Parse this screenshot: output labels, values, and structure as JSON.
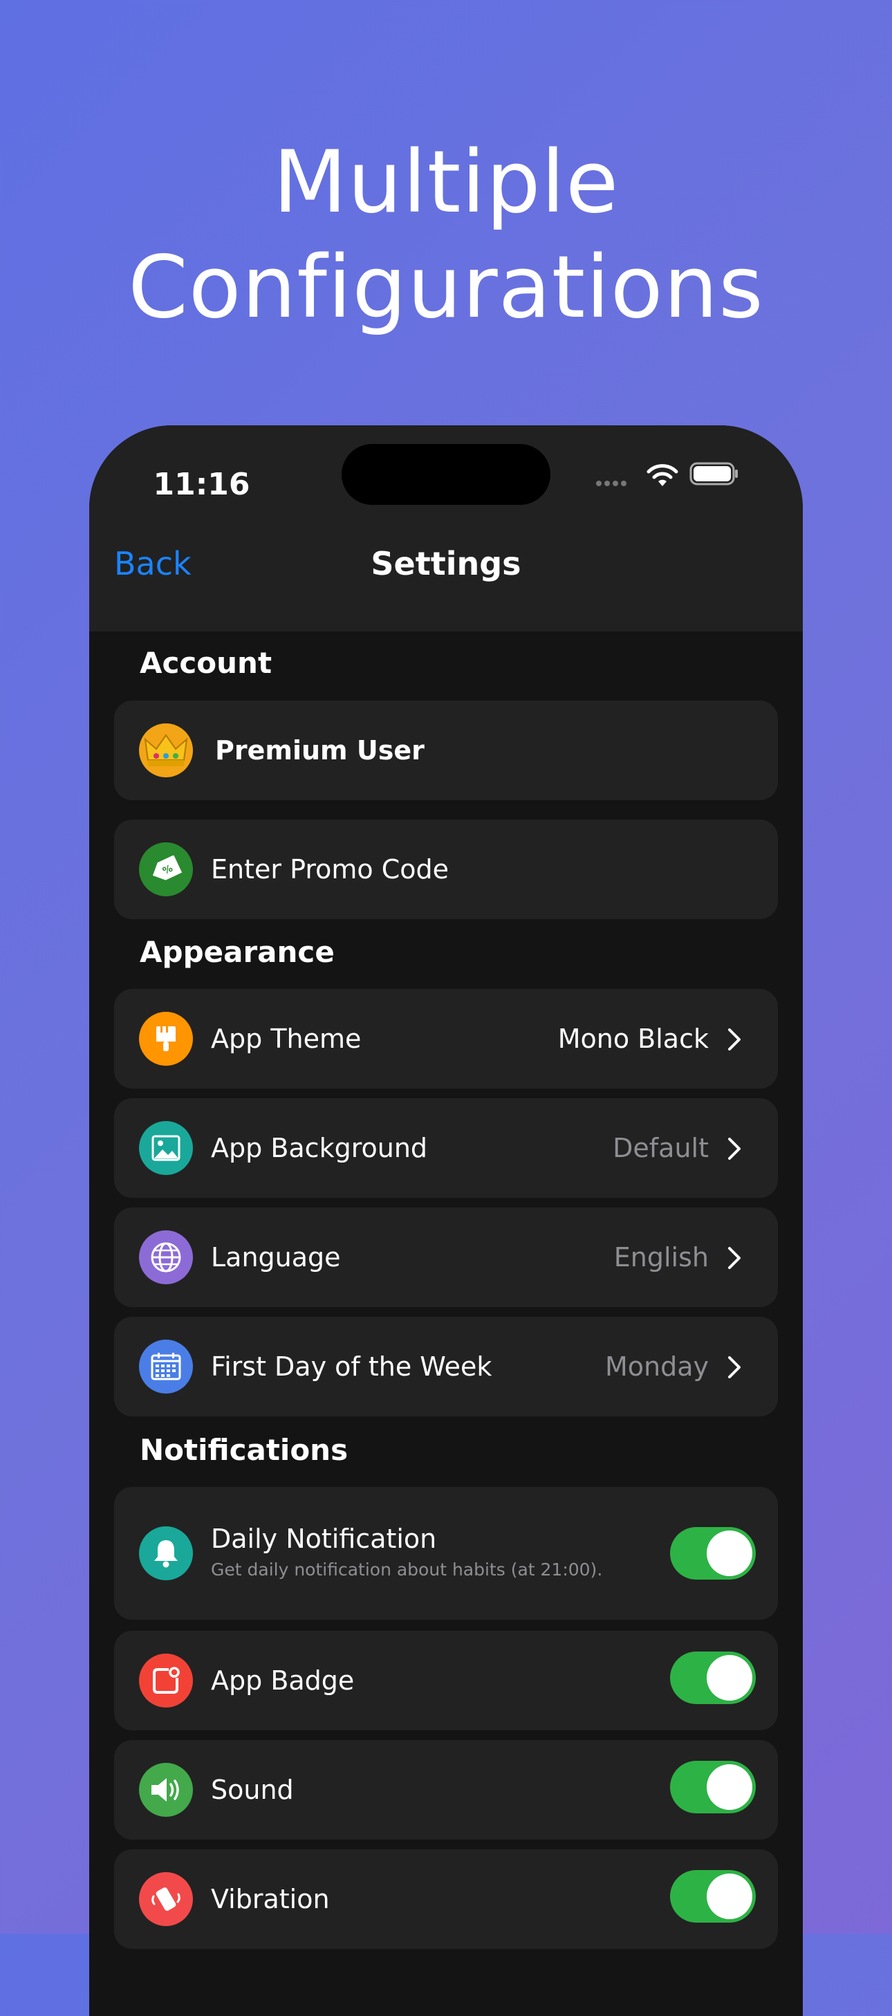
{
  "headline": [
    "Multiple",
    "Configurations"
  ],
  "status_bar": {
    "time": "11:16"
  },
  "nav": {
    "back_label": "Back",
    "title": "Settings"
  },
  "sections": {
    "account": "Account",
    "appearance": "Appearance",
    "notifications": "Notifications"
  },
  "account": {
    "premium_label": "Premium User",
    "promo_label": "Enter Promo Code"
  },
  "appearance": {
    "theme": {
      "label": "App Theme",
      "value": "Mono Black"
    },
    "background": {
      "label": "App Background",
      "value": "Default"
    },
    "language": {
      "label": "Language",
      "value": "English"
    },
    "first_day": {
      "label": "First Day of the Week",
      "value": "Monday"
    }
  },
  "notifications": {
    "daily": {
      "label": "Daily Notification",
      "subtitle": "Get daily notification about habits (at 21:00).",
      "on": true
    },
    "badge": {
      "label": "App Badge",
      "on": true
    },
    "sound": {
      "label": "Sound",
      "on": true
    },
    "vibration": {
      "label": "Vibration",
      "on": true
    }
  },
  "icons": {
    "premium": "crown-icon",
    "promo": "tag-icon",
    "theme": "paint-brush-icon",
    "background": "image-icon",
    "language": "globe-icon",
    "first_day": "calendar-icon",
    "daily": "bell-icon",
    "badge": "badge-icon",
    "sound": "speaker-icon",
    "vibration": "vibration-icon"
  },
  "colors": {
    "accent_blue": "#1a84ff",
    "toggle_on": "#2db245",
    "promo_green": "#2a8a2f",
    "theme_orange": "#ff9500",
    "background_teal": "#1aa89a",
    "language_purple": "#8c6bd6",
    "calendar_blue": "#4a7ee6",
    "bell_teal": "#1aa89a",
    "badge_red": "#f24236",
    "sound_green": "#43a94b",
    "vibration_red": "#f24a4a"
  }
}
